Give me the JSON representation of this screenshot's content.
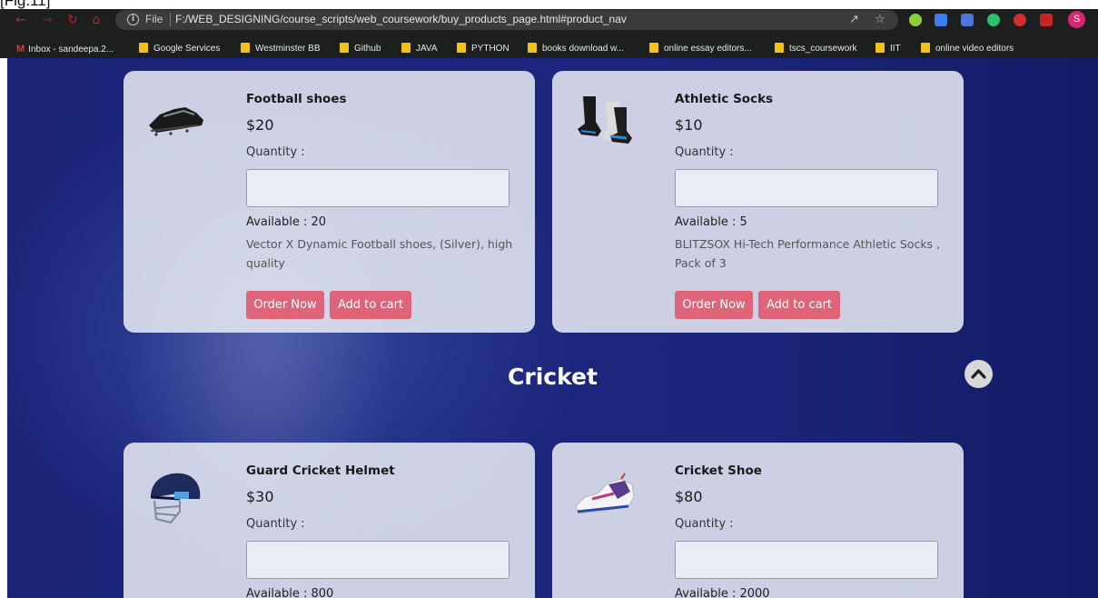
{
  "caption": "[Fig.11]",
  "browser": {
    "file_label": "File",
    "url": "F:/WEB_DESIGNING/course_scripts/web_coursework/buy_products_page.html#product_nav",
    "profile_initial": "S",
    "bookmarks": [
      {
        "label": "Inbox - sandeepa.2...",
        "icon": "gmail-icon"
      },
      {
        "label": "Google Services",
        "icon": "folder-icon"
      },
      {
        "label": "Westminster BB",
        "icon": "folder-icon"
      },
      {
        "label": "Github",
        "icon": "folder-icon"
      },
      {
        "label": "JAVA",
        "icon": "folder-icon"
      },
      {
        "label": "PYTHON",
        "icon": "folder-icon"
      },
      {
        "label": "books download w...",
        "icon": "folder-icon"
      },
      {
        "label": "online essay editors...",
        "icon": "folder-icon"
      },
      {
        "label": "tscs_coursework",
        "icon": "folder-icon"
      },
      {
        "label": "IIT",
        "icon": "folder-icon"
      },
      {
        "label": "online video editors",
        "icon": "folder-icon"
      }
    ]
  },
  "colors": {
    "button": "#e06479",
    "page_background": "#1c2680",
    "card_background": "#e6e8f2"
  },
  "products": [
    {
      "title": "Football shoes",
      "price": "$20",
      "quantity_label": "Quantity :",
      "quantity_value": "",
      "available": "Available : 20",
      "description": "Vector X Dynamic Football shoes, (Silver), high quality",
      "order_label": "Order Now",
      "cart_label": "Add to cart"
    },
    {
      "title": "Athletic Socks",
      "price": "$10",
      "quantity_label": "Quantity :",
      "quantity_value": "",
      "available": "Available : 5",
      "description": "BLITZSOX Hi-Tech Performance Athletic Socks , Pack of 3",
      "order_label": "Order Now",
      "cart_label": "Add to cart"
    },
    {
      "title": "Guard Cricket Helmet",
      "price": "$30",
      "quantity_label": "Quantity :",
      "quantity_value": "",
      "available": "Available : 800"
    },
    {
      "title": "Cricket Shoe",
      "price": "$80",
      "quantity_label": "Quantity :",
      "quantity_value": "",
      "available": "Available : 2000"
    }
  ],
  "section": {
    "title": "Cricket"
  },
  "scroll_top_icon": "chevron-up-icon"
}
